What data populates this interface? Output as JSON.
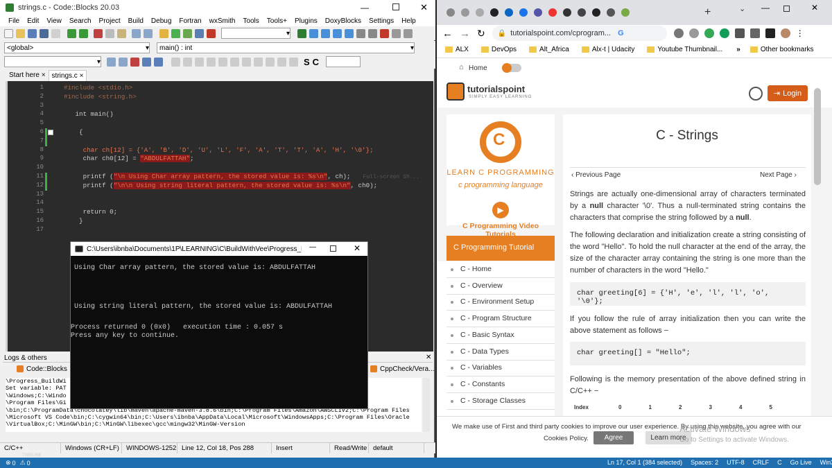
{
  "cb": {
    "title": "strings.c - Code::Blocks 20.03",
    "menu": [
      "File",
      "Edit",
      "View",
      "Search",
      "Project",
      "Build",
      "Debug",
      "Fortran",
      "wxSmith",
      "Tools",
      "Tools+",
      "Plugins",
      "DoxyBlocks",
      "Settings",
      "Help"
    ],
    "scope": "<global>",
    "func": "main() : int",
    "tabs": [
      "Start here",
      "strings.c"
    ],
    "tab_close": "×",
    "lines": [
      {
        "n": "1",
        "code": "#include <stdio.h>",
        "kind": "pp"
      },
      {
        "n": "2",
        "code": "#include <string.h>",
        "kind": "pp"
      },
      {
        "n": "3",
        "code": "",
        "kind": "plain"
      },
      {
        "n": "4",
        "code": "   int main()",
        "kind": "plain"
      },
      {
        "n": "5",
        "code": "",
        "kind": "plain"
      },
      {
        "n": "6",
        "code": "    {",
        "kind": "plain"
      },
      {
        "n": "7",
        "code": "",
        "kind": "plain"
      },
      {
        "n": "8",
        "code": "     char ch[12] = {'A', 'B', 'D', 'U', 'L', 'F', 'A', 'T', 'T', 'A', 'H', '\\0'};",
        "kind": "chars"
      },
      {
        "n": "9",
        "code": "     char ch0[12] = ",
        "kind": "str9"
      },
      {
        "n": "10",
        "code": "",
        "kind": "plain"
      },
      {
        "n": "11",
        "code": "     printf (",
        "kind": "str11"
      },
      {
        "n": "12",
        "code": "     printf (",
        "kind": "str12"
      },
      {
        "n": "13",
        "code": "",
        "kind": "plain"
      },
      {
        "n": "14",
        "code": "",
        "kind": "plain"
      },
      {
        "n": "15",
        "code": "     return 0;",
        "kind": "plain"
      },
      {
        "n": "16",
        "code": "    }",
        "kind": "plain"
      },
      {
        "n": "17",
        "code": "",
        "kind": "plain"
      }
    ],
    "str9": "\"ABDULFATTAH\"",
    "str9_tail": ";",
    "str11": "\"\\n Using Char array pattern, the stored value is: %s\\n\"",
    "str11_tail": ", ch);",
    "str12": "\"\\n\\n Using string literal pattern, the stored value is: %s\\n\"",
    "str12_tail": ", ch0);",
    "ghost": "Full-screen Sh...",
    "logs_title": "Logs & others",
    "logs_tabs": [
      "Code::Blocks",
      "CppCheck/Vera..."
    ],
    "logs_lines": [
      "\\Progress_BuildWi",
      "Set variable: PAT                                                                    ws\\System32;C:",
      "\\Windows;C:\\Windo                                                                   enSSH;C:",
      "\\Program Files\\Gi                                                                   jdk1.8.0_211",
      "\\bin;C:\\ProgramData\\chocolatey\\lib\\maven\\apache-maven-3.8.6\\bin;C:\\Program Files\\Amazon\\AWSCLIV2;C:\\Program Files",
      "\\Microsoft VS Code\\bin;C:\\cygwin64\\bin;C:\\Users\\ibnba\\AppData\\Local\\Microsoft\\WindowsApps;C:\\Program Files\\Oracle",
      "\\VirtualBox;C:\\MinGW\\bin;C:\\MinGW\\libexec\\gcc\\mingw32\\MinGW-Version"
    ],
    "status": [
      "C/C++",
      "Windows (CR+LF)",
      "WINDOWS-1252",
      "Line 12, Col 18, Pos 288",
      "Insert",
      "Read/Write",
      "default"
    ]
  },
  "console": {
    "title": "C:\\Users\\ibnba\\Documents\\1P\\LEARNING\\C\\BuildWithVee\\Progress_Build...",
    "lines": [
      "Using Char array pattern, the stored value is: ABDULFATTAH",
      "",
      "",
      "Using string literal pattern, the stored value is: ABDULFATTAH",
      "",
      "Process returned 0 (0x0)   execution time : 0.057 s",
      "Press any key to continue."
    ]
  },
  "browser": {
    "url": "tutorialspoint.com/cprogram...",
    "tab_add": "+",
    "bookmarks": [
      "ALX",
      "DevOps",
      "Alt_Africa",
      "Alx-t | Udacity",
      "Youtube Thumbnail...",
      "Other bookmarks"
    ],
    "more": "»",
    "home": "Home",
    "logo_main": "tutorialspoint",
    "logo_sub": "SIMPLY EASY LEARNING",
    "login": "Login",
    "learn_c": "LEARN C PROGRAMMING",
    "c_lang": "c programming language",
    "video_tutorials": "C Programming Video Tutorials",
    "tutorial_head": "C Programming Tutorial",
    "side_items": [
      "C - Home",
      "C - Overview",
      "C - Environment Setup",
      "C - Program Structure",
      "C - Basic Syntax",
      "C - Data Types",
      "C - Variables",
      "C - Constants",
      "C - Storage Classes"
    ],
    "page_title": "C - Strings",
    "prev": "Previous Page",
    "next": "Next Page",
    "para1_a": "Strings are actually one-dimensional array of characters terminated by a ",
    "para1_b": "null",
    "para1_c": " character '\\0'. Thus a null-terminated string contains the characters that comprise the string followed by a ",
    "para1_d": "null",
    "para1_e": ".",
    "para2": "The following declaration and initialization create a string consisting of the word \"Hello\". To hold the null character at the end of the array, the size of the character array containing the string is one more than the number of characters in the word \"Hello.\"",
    "code1": "char greeting[6] = {'H', 'e', 'l', 'l', 'o', '\\0'};",
    "para3": "If you follow the rule of array initialization then you can write the above statement as follows −",
    "code2": "char greeting[] = \"Hello\";",
    "para4": "Following is the memory presentation of the above defined string in C/C++ −",
    "mem_label": "Index",
    "mem_index": [
      "0",
      "1",
      "2",
      "3",
      "4",
      "5"
    ],
    "cookie": "We make use of First and third party cookies to improve our user experience. By using this website, you agree with our",
    "cookies_policy": "Cookies Policy.",
    "agree": "Agree",
    "learn_more": "Learn more",
    "activate1": "Activate Windows",
    "activate2": "Go to Settings to activate Windows."
  },
  "taskbar": {
    "errors": "0",
    "warnings": "0",
    "timeline": "TIMELINE",
    "right": [
      "Ln 17, Col 1 (384 selected)",
      "Spaces: 2",
      "UTF-8",
      "CRLF",
      "C",
      "Go Live",
      "Win32"
    ]
  },
  "colors": {
    "accent_orange": "#e67e22",
    "tp_orange": "#d65c1a",
    "code_bg": "#2b2b2b",
    "taskbar": "#1f6fb0"
  }
}
